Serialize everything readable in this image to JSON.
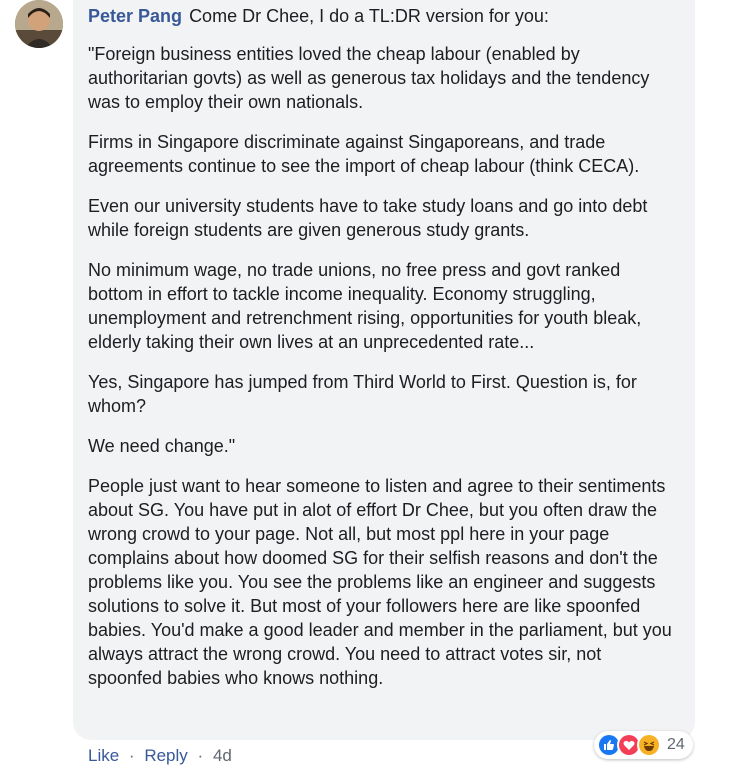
{
  "comment": {
    "author": "Peter Pang",
    "first_line": "Come Dr Chee, I do a TL:DR version for you:",
    "paragraphs": [
      "\"Foreign business entities loved the cheap labour (enabled by authoritarian govts) as well as generous tax holidays and the tendency was to employ their own nationals.",
      "Firms in Singapore discriminate against Singaporeans, and trade agreements continue to see the import of cheap labour (think CECA).",
      "Even our university students have to take study loans and go into debt while foreign students are given generous study grants.",
      "No minimum wage, no trade unions, no free press and govt ranked bottom in effort to tackle income inequality. Economy struggling, unemployment and retrenchment rising, opportunities for youth bleak, elderly taking their own lives at an unprecedented rate...",
      "Yes, Singapore has jumped from Third World to First. Question is, for whom?",
      "We need change.\"",
      "People just want to hear someone to listen and agree to their sentiments about SG. You have put in alot of effort Dr Chee, but you often draw the wrong crowd to your page. Not all, but most ppl here in your page complains about how doomed SG for their selfish reasons and don't the problems like you. You see the problems like an engineer and suggests solutions to solve it. But most of your followers here are like spoonfed babies. You'd make a good leader and member in the parliament, but you always attract the wrong crowd. You need to attract votes sir, not spoonfed babies who knows nothing."
    ]
  },
  "reactions": {
    "icons": [
      "like-icon",
      "love-icon",
      "haha-icon"
    ],
    "count": "24"
  },
  "actions": {
    "like": "Like",
    "reply": "Reply",
    "separator": "·",
    "time": "4d"
  },
  "colors": {
    "author": "#385898",
    "bubble": "#f2f3f5",
    "like": "#1877f2",
    "love": "#f33e58",
    "haha": "#f7b125"
  }
}
